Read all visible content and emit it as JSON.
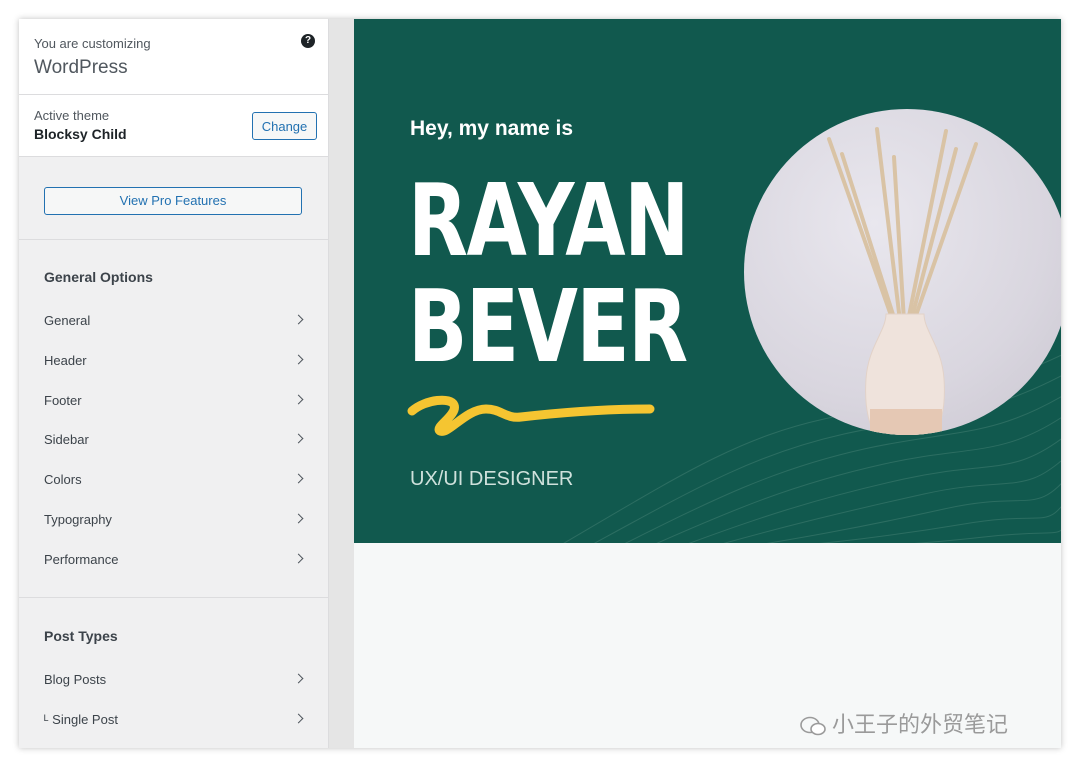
{
  "customizer": {
    "customizing_label": "You are customizing",
    "site_name": "WordPress",
    "help_icon": "question-circle-icon"
  },
  "theme": {
    "label": "Active theme",
    "name": "Blocksy Child",
    "change_label": "Change"
  },
  "pro_button": "View Pro Features",
  "general_options": {
    "title": "General Options",
    "items": [
      {
        "label": "General"
      },
      {
        "label": "Header"
      },
      {
        "label": "Footer"
      },
      {
        "label": "Sidebar"
      },
      {
        "label": "Colors"
      },
      {
        "label": "Typography"
      },
      {
        "label": "Performance"
      }
    ]
  },
  "post_types": {
    "title": "Post Types",
    "items": [
      {
        "label": "Blog Posts"
      },
      {
        "label": "ᴸ Single Post"
      }
    ]
  },
  "hero": {
    "greeting": "Hey, my name is",
    "first_name": "RAYAN",
    "last_name": "BEVER",
    "role": "UX/UI DESIGNER",
    "background": "#11594e",
    "accent": "#f5c531"
  },
  "watermark": "小王子的外贸笔记"
}
